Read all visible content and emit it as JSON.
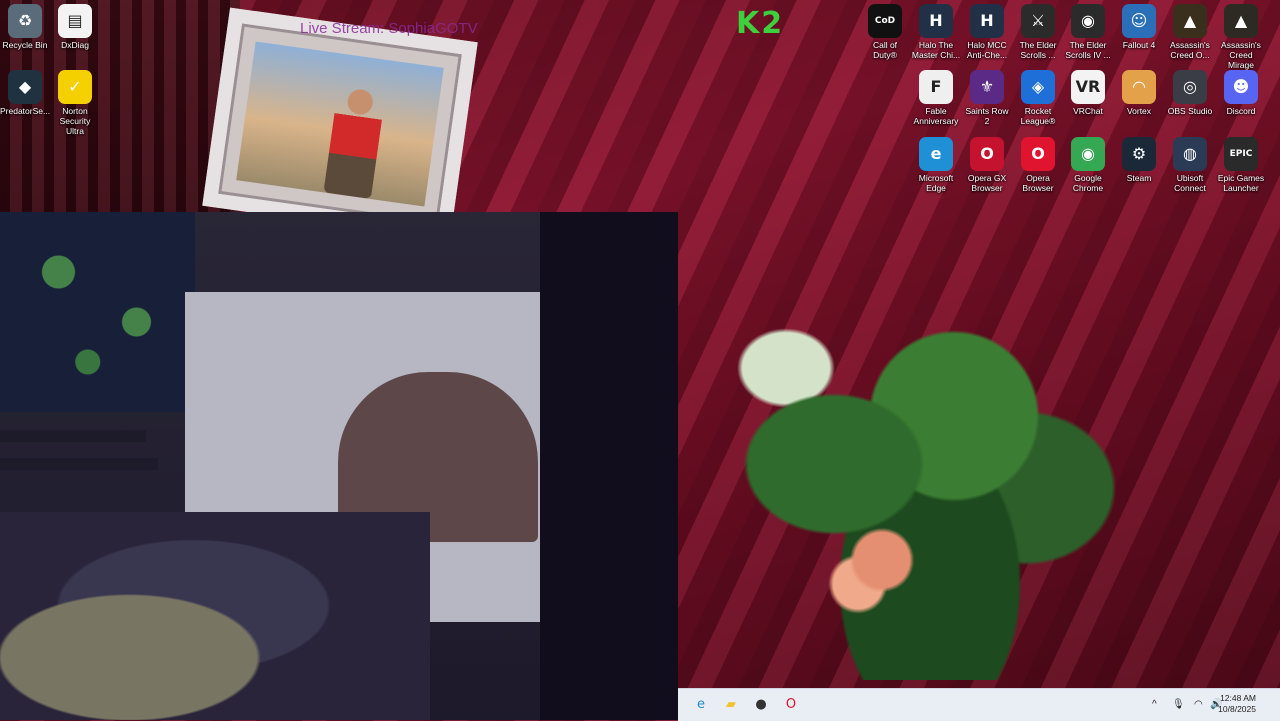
{
  "wallpaper": {
    "watermark_text": "Live Stream: SophiaGOTV"
  },
  "overlay_logo": "K2",
  "desktop_icons": [
    {
      "label": "Recycle Bin",
      "icon": "recycle-bin-icon",
      "glyph": "♻",
      "bg": "#5a6b7a"
    },
    {
      "label": "DxDiag",
      "icon": "document-icon",
      "glyph": "▤",
      "bg": "#f3f3f3"
    },
    {
      "label": "PredatorSe...",
      "icon": "predatorsense-icon",
      "glyph": "◆",
      "bg": "#20323f"
    },
    {
      "label": "Norton Security Ultra",
      "icon": "norton-icon",
      "glyph": "✓",
      "bg": "#f5d000"
    },
    {
      "label": "Call of Duty®",
      "icon": "call-of-duty-icon",
      "glyph": "CoD",
      "bg": "#111111"
    },
    {
      "label": "Halo The Master Chi...",
      "icon": "halo-mcc-icon",
      "glyph": "H",
      "bg": "#223047"
    },
    {
      "label": "Halo MCC Anti-Che...",
      "icon": "halo-anticheat-icon",
      "glyph": "H",
      "bg": "#223047"
    },
    {
      "label": "The Elder Scrolls ...",
      "icon": "skyrim-icon",
      "glyph": "⚔",
      "bg": "#2b2b2b"
    },
    {
      "label": "The Elder Scrolls IV ...",
      "icon": "oblivion-icon",
      "glyph": "◉",
      "bg": "#2b2b2b"
    },
    {
      "label": "Fallout 4",
      "icon": "fallout-icon",
      "glyph": "☺",
      "bg": "#2a6fb8"
    },
    {
      "label": "Assassin's Creed O...",
      "icon": "ac-origins-icon",
      "glyph": "▲",
      "bg": "#3a2f1d"
    },
    {
      "label": "Assassin's Creed Mirage",
      "icon": "ac-mirage-icon",
      "glyph": "▲",
      "bg": "#2d2a24"
    },
    {
      "label": "Fable Anniversary",
      "icon": "fable-icon",
      "glyph": "F",
      "bg": "#efefef"
    },
    {
      "label": "Saints Row 2",
      "icon": "saints-row-icon",
      "glyph": "⚜",
      "bg": "#5a2a86"
    },
    {
      "label": "Rocket League®",
      "icon": "rocket-league-icon",
      "glyph": "◈",
      "bg": "#1e6fd8"
    },
    {
      "label": "VRChat",
      "icon": "vrchat-icon",
      "glyph": "VR",
      "bg": "#f3f3f3"
    },
    {
      "label": "Vortex",
      "icon": "vortex-icon",
      "glyph": "◠",
      "bg": "#e3a24a"
    },
    {
      "label": "OBS Studio",
      "icon": "obs-icon",
      "glyph": "◎",
      "bg": "#3a3d45"
    },
    {
      "label": "Discord",
      "icon": "discord-icon",
      "glyph": "☻",
      "bg": "#5865f2"
    },
    {
      "label": "Microsoft Edge",
      "icon": "edge-icon",
      "glyph": "e",
      "bg": "#1f8fd6"
    },
    {
      "label": "Opera GX Browser",
      "icon": "opera-gx-icon",
      "glyph": "O",
      "bg": "#c4122f"
    },
    {
      "label": "Opera Browser",
      "icon": "opera-icon",
      "glyph": "O",
      "bg": "#e0142e"
    },
    {
      "label": "Google Chrome",
      "icon": "chrome-icon",
      "glyph": "◉",
      "bg": "#34a853"
    },
    {
      "label": "Steam",
      "icon": "steam-icon",
      "glyph": "⚙",
      "bg": "#1b2838"
    },
    {
      "label": "Ubisoft Connect",
      "icon": "ubisoft-icon",
      "glyph": "◍",
      "bg": "#2b3a55"
    },
    {
      "label": "Epic Games Launcher",
      "icon": "epic-games-icon",
      "glyph": "EPIC",
      "bg": "#2a2a2a"
    }
  ],
  "taskbar": {
    "pinned": [
      {
        "name": "edge-taskbar-icon",
        "glyph": "e",
        "color": "#1f8fd6"
      },
      {
        "name": "file-explorer-icon",
        "glyph": "▰",
        "color": "#f2c230"
      },
      {
        "name": "app-taskbar-icon",
        "glyph": "●",
        "color": "#333333"
      },
      {
        "name": "opera-taskbar-icon",
        "glyph": "O",
        "color": "#e0142e"
      }
    ],
    "tray": {
      "chevron": "^",
      "clock_time": "12:48 AM",
      "clock_date": "10/8/2025"
    }
  }
}
